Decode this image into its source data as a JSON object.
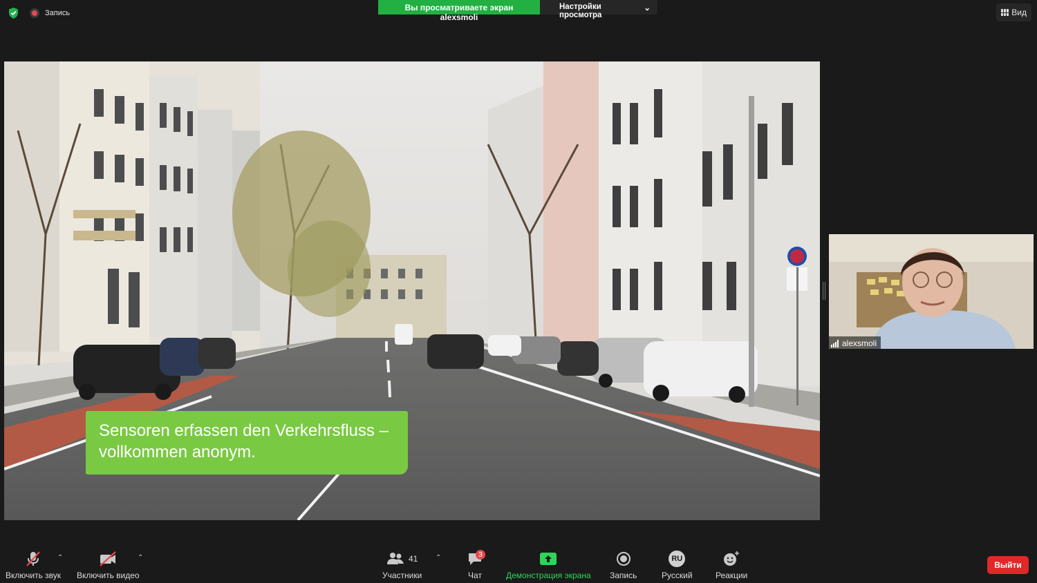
{
  "topbar": {
    "recording_label": "Запись",
    "viewing_banner": "Вы просматриваете экран alexsmoli",
    "view_options": "Настройки просмотра",
    "view_button": "Вид"
  },
  "shared_screen": {
    "caption": "Sensoren erfassen den Verkehrsfluss – vollkommen anonym."
  },
  "participant": {
    "name": "alexsmoli"
  },
  "toolbar": {
    "mute_label": "Включить звук",
    "video_label": "Включить видео",
    "participants_label": "Участники",
    "participants_count": "41",
    "chat_label": "Чат",
    "chat_badge": "3",
    "share_label": "Демонстрация экрана",
    "record_label": "Запись",
    "language_code": "RU",
    "language_label": "Русский",
    "reactions_label": "Реакции",
    "leave_label": "Выйти"
  },
  "colors": {
    "share_green": "#21b041",
    "caption_green": "#7ac943",
    "leave_red": "#e02828"
  }
}
